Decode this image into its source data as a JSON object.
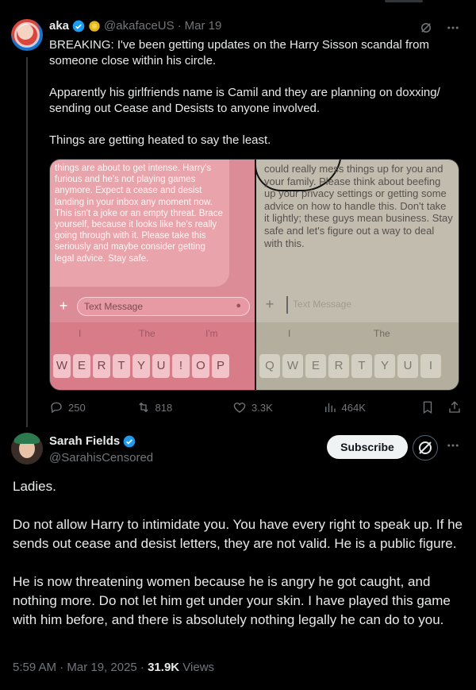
{
  "parent_tweet": {
    "name": "aka",
    "handle": "@akafaceUS",
    "separator": "·",
    "date": "Mar 19",
    "text": "BREAKING: I've been getting updates on the Harry Sisson scandal from someone close within his circle.\n\nApparently his girlfriends name is Camil and they are planning on doxxing/ sending out Cease and Desists to anyone involved.\n\nThings are getting heated to say the least.",
    "media": {
      "left_message": "things are about to get intense. Harry's furious and he's not playing games anymore. Expect a cease and desist landing in your inbox any moment now. This isn't a joke or an empty threat. Brace yourself, because it looks like he's really going through with it. Please take this seriously and maybe consider getting legal advice. Stay safe.",
      "left_input_placeholder": "Text Message",
      "left_suggestions": [
        "I",
        "The",
        "I'm"
      ],
      "left_keys": [
        "W",
        "E",
        "R",
        "T",
        "Y",
        "U",
        "!",
        "O",
        "P"
      ],
      "right_message": "could really mess things up for you and your family. Please think about beefing up your privacy settings or getting some advice on how to handle this. Don't take it lightly; these guys mean business. Stay safe and let's figure out a way to deal with this.",
      "right_input_placeholder": "Text Message",
      "right_suggestions": [
        "I",
        "The"
      ],
      "right_keys": [
        "Q",
        "W",
        "E",
        "R",
        "T",
        "Y",
        "U",
        "I"
      ]
    },
    "stats": {
      "replies": "250",
      "reposts": "818",
      "likes": "3.3K",
      "views": "464K"
    }
  },
  "main_tweet": {
    "name": "Sarah Fields",
    "handle": "@SarahisCensored",
    "subscribe_label": "Subscribe",
    "text": "Ladies.\n\nDo not allow Harry to intimidate you. You have every right to speak up.  If he sends out cease and desist letters, they are not valid. He is a public figure.\n\nHe is now threatening women  because he is angry he got caught, and nothing more. Do not let him get under your skin. I have played this game with him before, and there is absolutely nothing legally he can do to you.",
    "time": "5:59 AM · Mar 19, 2025 · ",
    "views_count": "31.9K",
    "views_label": " Views"
  },
  "colors": {
    "verified_blue": "#1d9bf0",
    "gold_badge": "#e2b719",
    "muted": "#71767b",
    "text": "#e7e9ea"
  },
  "icons": [
    "grok-icon",
    "more-icon",
    "reply-icon",
    "repost-icon",
    "like-icon",
    "views-icon",
    "bookmark-icon",
    "share-icon",
    "verified-badge-icon"
  ]
}
